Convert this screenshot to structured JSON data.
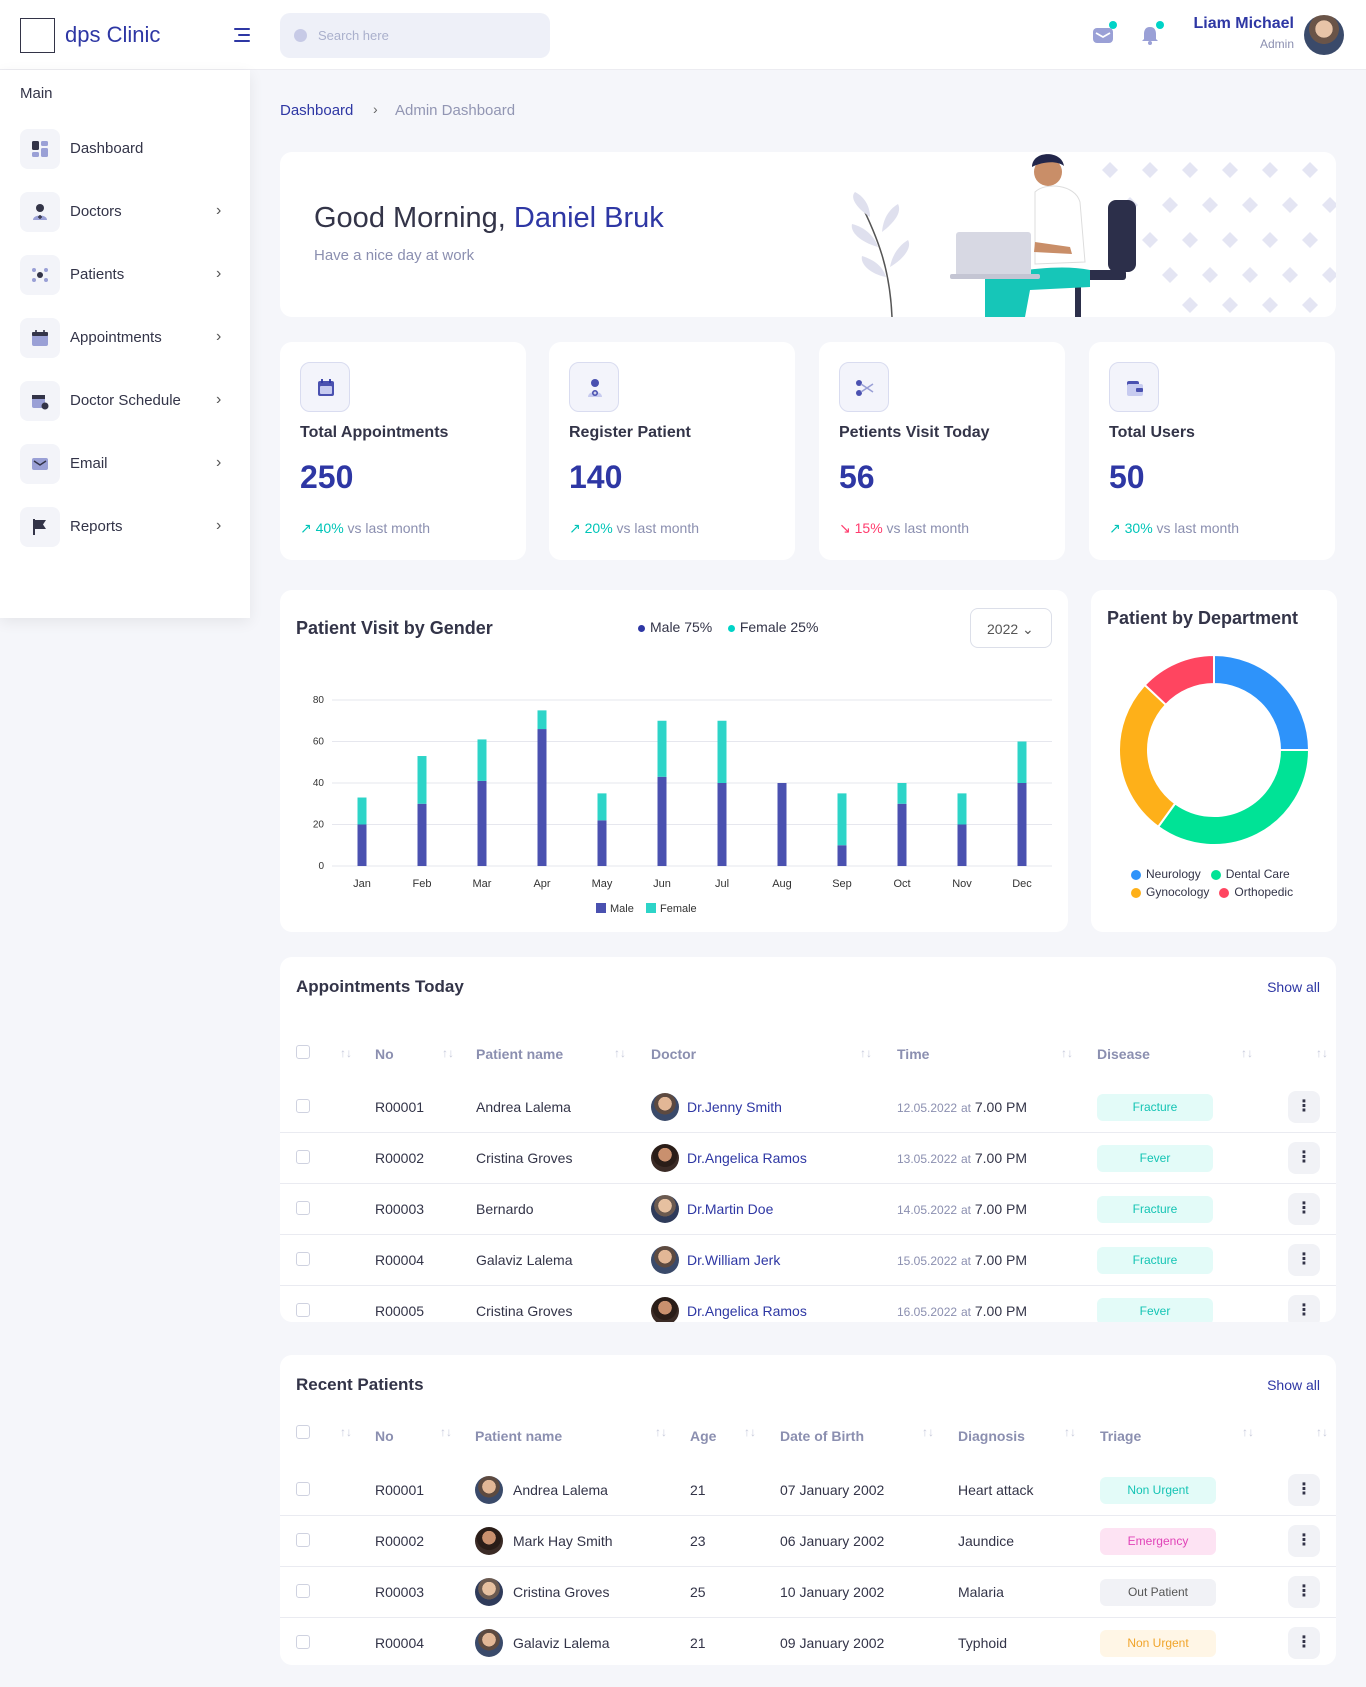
{
  "header": {
    "app_name": "dps Clinic",
    "search_placeholder": "Search here",
    "user_name": "Liam Michael",
    "user_role": "Admin"
  },
  "sidebar": {
    "section": "Main",
    "items": [
      {
        "label": "Dashboard",
        "icon": "dashboard-icon"
      },
      {
        "label": "Doctors",
        "icon": "doctor-icon"
      },
      {
        "label": "Patients",
        "icon": "patients-icon"
      },
      {
        "label": "Appointments",
        "icon": "calendar-icon"
      },
      {
        "label": "Doctor Schedule",
        "icon": "schedule-icon"
      },
      {
        "label": "Email",
        "icon": "mail-icon"
      },
      {
        "label": "Reports",
        "icon": "flag-icon"
      }
    ]
  },
  "breadcrumb": {
    "root": "Dashboard",
    "current": "Admin Dashboard"
  },
  "welcome": {
    "greeting": "Good Morning,",
    "name": "Daniel Bruk",
    "subtitle": "Have a nice day at work"
  },
  "stats": [
    {
      "label": "Total Appointments",
      "value": "250",
      "change": "40%",
      "direction": "up",
      "suffix": "vs last month"
    },
    {
      "label": "Register Patient",
      "value": "140",
      "change": "20%",
      "direction": "up",
      "suffix": "vs last month"
    },
    {
      "label": "Petients Visit Today",
      "value": "56",
      "change": "15%",
      "direction": "down",
      "suffix": "vs last month"
    },
    {
      "label": "Total Users",
      "value": "50",
      "change": "30%",
      "direction": "up",
      "suffix": "vs last month"
    }
  ],
  "gender_chart": {
    "title": "Patient Visit by Gender",
    "legend_male": "Male 75%",
    "legend_female": "Female 25%",
    "year": "2022"
  },
  "dept_chart": {
    "title": "Patient by Department"
  },
  "colors": {
    "primary": "#2e37a4",
    "accent": "#00d3c7",
    "male": "#4a51b0",
    "female": "#2dd4c8",
    "neurology": "#2e93fa",
    "dental": "#00e396",
    "gynocology": "#feb019",
    "orthopedic": "#ff4560"
  },
  "chart_data": [
    {
      "type": "bar",
      "stacked": true,
      "categories": [
        "Jan",
        "Feb",
        "Mar",
        "Apr",
        "May",
        "Jun",
        "Jul",
        "Aug",
        "Sep",
        "Oct",
        "Nov",
        "Dec"
      ],
      "series": [
        {
          "name": "Male",
          "values": [
            20,
            30,
            41,
            66,
            22,
            43,
            40,
            40,
            10,
            30,
            20,
            40
          ],
          "color": "#4a51b0"
        },
        {
          "name": "Female",
          "values": [
            13,
            23,
            20,
            9,
            13,
            27,
            30,
            0,
            25,
            10,
            15,
            20
          ],
          "color": "#2dd4c8"
        }
      ],
      "ylim": [
        0,
        80
      ],
      "yticks": [
        0,
        20,
        40,
        60,
        80
      ],
      "grid": true,
      "legend": "bottom"
    },
    {
      "type": "pie",
      "donut": true,
      "labels": [
        "Neurology",
        "Dental Care",
        "Gynocology",
        "Orthopedic"
      ],
      "values": [
        25,
        35,
        27,
        13
      ],
      "colors": [
        "#2e93fa",
        "#00e396",
        "#feb019",
        "#ff4560"
      ],
      "legend": "bottom"
    }
  ],
  "appointments": {
    "title": "Appointments Today",
    "show_all": "Show all",
    "columns": [
      "No",
      "Patient name",
      "Doctor",
      "Time",
      "Disease"
    ],
    "rows": [
      {
        "no": "R00001",
        "patient": "Andrea Lalema",
        "doctor": "Dr.Jenny Smith",
        "date": "12.05.2022",
        "at": "at",
        "time": "7.00 PM",
        "disease": "Fracture"
      },
      {
        "no": "R00002",
        "patient": "Cristina Groves",
        "doctor": "Dr.Angelica Ramos",
        "date": "13.05.2022",
        "at": "at",
        "time": "7.00 PM",
        "disease": "Fever"
      },
      {
        "no": "R00003",
        "patient": "Bernardo",
        "doctor": "Dr.Martin Doe",
        "date": "14.05.2022",
        "at": "at",
        "time": "7.00 PM",
        "disease": "Fracture"
      },
      {
        "no": "R00004",
        "patient": "Galaviz Lalema",
        "doctor": "Dr.William Jerk",
        "date": "15.05.2022",
        "at": "at",
        "time": "7.00 PM",
        "disease": "Fracture"
      },
      {
        "no": "R00005",
        "patient": "Cristina Groves",
        "doctor": "Dr.Angelica Ramos",
        "date": "16.05.2022",
        "at": "at",
        "time": "7.00 PM",
        "disease": "Fever"
      }
    ]
  },
  "recent_patients": {
    "title": "Recent Patients",
    "show_all": "Show all",
    "columns": [
      "No",
      "Patient name",
      "Age",
      "Date of Birth",
      "Diagnosis",
      "Triage"
    ],
    "rows": [
      {
        "no": "R00001",
        "patient": "Andrea Lalema",
        "age": "21",
        "dob": "07 January 2002",
        "diagnosis": "Heart attack",
        "triage": "Non Urgent",
        "triage_style": "teal"
      },
      {
        "no": "R00002",
        "patient": "Mark Hay Smith",
        "age": "23",
        "dob": "06 January 2002",
        "diagnosis": "Jaundice",
        "triage": "Emergency",
        "triage_style": "pink"
      },
      {
        "no": "R00003",
        "patient": "Cristina Groves",
        "age": "25",
        "dob": "10 January 2002",
        "diagnosis": "Malaria",
        "triage": "Out Patient",
        "triage_style": "gray"
      },
      {
        "no": "R00004",
        "patient": "Galaviz Lalema",
        "age": "21",
        "dob": "09 January 2002",
        "diagnosis": "Typhoid",
        "triage": "Non Urgent",
        "triage_style": "orange"
      }
    ]
  }
}
